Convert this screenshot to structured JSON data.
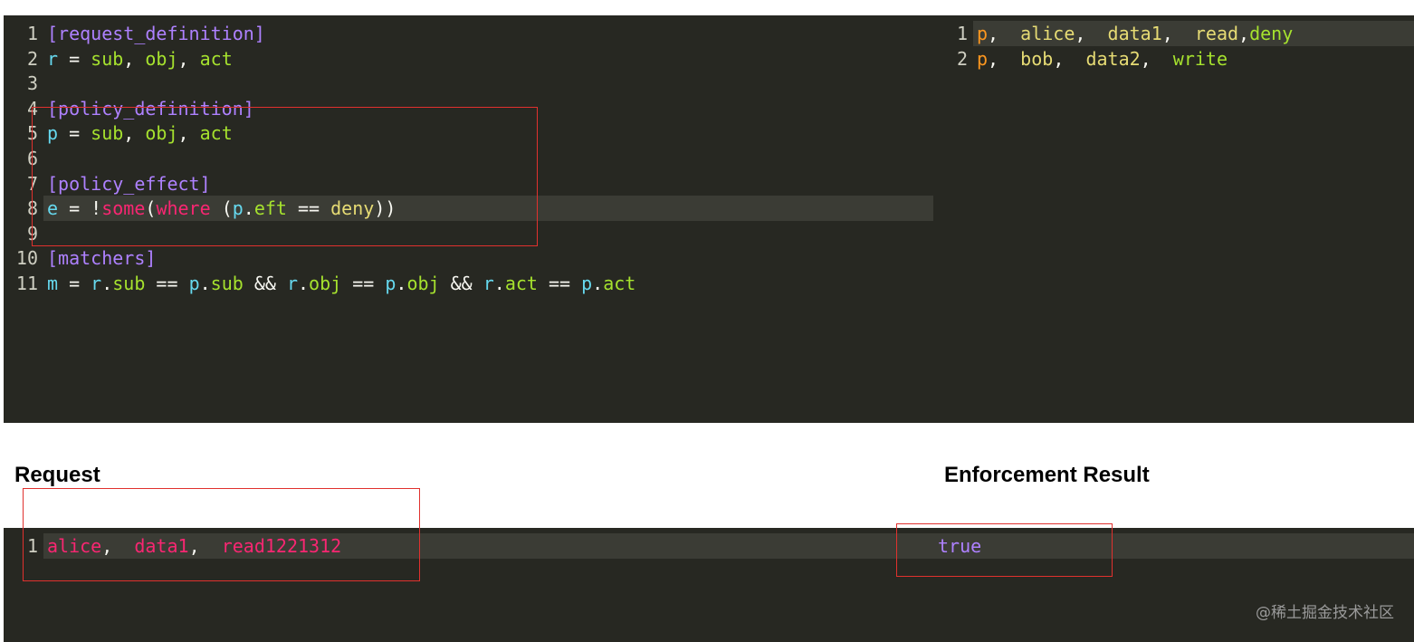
{
  "model_editor": {
    "lines": [
      {
        "n": "1",
        "tokens": [
          [
            "[request_definition]",
            "t-section"
          ]
        ]
      },
      {
        "n": "2",
        "tokens": [
          [
            "r",
            "t-var"
          ],
          [
            " = ",
            "t-op"
          ],
          [
            "sub",
            "t-green"
          ],
          [
            ", ",
            "t-op"
          ],
          [
            "obj",
            "t-green"
          ],
          [
            ", ",
            "t-op"
          ],
          [
            "act",
            "t-green"
          ]
        ]
      },
      {
        "n": "3",
        "tokens": []
      },
      {
        "n": "4",
        "tokens": [
          [
            "[policy_definition]",
            "t-section"
          ]
        ]
      },
      {
        "n": "5",
        "tokens": [
          [
            "p",
            "t-var"
          ],
          [
            " = ",
            "t-op"
          ],
          [
            "sub",
            "t-green"
          ],
          [
            ", ",
            "t-op"
          ],
          [
            "obj",
            "t-green"
          ],
          [
            ", ",
            "t-op"
          ],
          [
            "act",
            "t-green"
          ]
        ]
      },
      {
        "n": "6",
        "tokens": []
      },
      {
        "n": "7",
        "tokens": [
          [
            "[policy_effect]",
            "t-section"
          ]
        ]
      },
      {
        "n": "8",
        "active": true,
        "tokens": [
          [
            "e",
            "t-var"
          ],
          [
            " = ",
            "t-op"
          ],
          [
            "!",
            "t-op"
          ],
          [
            "some",
            "t-func"
          ],
          [
            "(",
            "t-op"
          ],
          [
            "where",
            "t-func"
          ],
          [
            " (",
            "t-op"
          ],
          [
            "p",
            "t-var"
          ],
          [
            ".",
            "t-op"
          ],
          [
            "eft",
            "t-green"
          ],
          [
            " == ",
            "t-op"
          ],
          [
            "deny",
            "t-yellow"
          ],
          [
            "))",
            "t-op"
          ]
        ]
      },
      {
        "n": "9",
        "tokens": []
      },
      {
        "n": "10",
        "tokens": [
          [
            "[matchers]",
            "t-section"
          ]
        ]
      },
      {
        "n": "11",
        "tokens": [
          [
            "m",
            "t-var"
          ],
          [
            " = ",
            "t-op"
          ],
          [
            "r",
            "t-var"
          ],
          [
            ".",
            "t-op"
          ],
          [
            "sub",
            "t-green"
          ],
          [
            " == ",
            "t-op"
          ],
          [
            "p",
            "t-var"
          ],
          [
            ".",
            "t-op"
          ],
          [
            "sub",
            "t-green"
          ],
          [
            " && ",
            "t-op"
          ],
          [
            "r",
            "t-var"
          ],
          [
            ".",
            "t-op"
          ],
          [
            "obj",
            "t-green"
          ],
          [
            " == ",
            "t-op"
          ],
          [
            "p",
            "t-var"
          ],
          [
            ".",
            "t-op"
          ],
          [
            "obj",
            "t-green"
          ],
          [
            " && ",
            "t-op"
          ],
          [
            "r",
            "t-var"
          ],
          [
            ".",
            "t-op"
          ],
          [
            "act",
            "t-green"
          ],
          [
            " == ",
            "t-op"
          ],
          [
            "p",
            "t-var"
          ],
          [
            ".",
            "t-op"
          ],
          [
            "act",
            "t-green"
          ]
        ]
      }
    ]
  },
  "policy_editor": {
    "lines": [
      {
        "n": "1",
        "active": true,
        "tokens": [
          [
            "p",
            "t-orange"
          ],
          [
            ", ",
            "t-op"
          ],
          [
            " alice",
            "t-yellow"
          ],
          [
            ", ",
            "t-op"
          ],
          [
            " data1",
            "t-yellow"
          ],
          [
            ", ",
            "t-op"
          ],
          [
            " read",
            "t-yellow"
          ],
          [
            ",",
            "t-op"
          ],
          [
            "deny",
            "t-green"
          ]
        ]
      },
      {
        "n": "2",
        "tokens": [
          [
            "p",
            "t-orange"
          ],
          [
            ", ",
            "t-op"
          ],
          [
            " bob",
            "t-yellow"
          ],
          [
            ", ",
            "t-op"
          ],
          [
            " data2",
            "t-yellow"
          ],
          [
            ", ",
            "t-op"
          ],
          [
            " write",
            "t-green"
          ]
        ]
      }
    ]
  },
  "request": {
    "heading": "Request",
    "lines": [
      {
        "n": "1",
        "active": true,
        "tokens": [
          [
            "alice",
            "t-func"
          ],
          [
            ", ",
            "t-op"
          ],
          [
            " data1",
            "t-func"
          ],
          [
            ", ",
            "t-op"
          ],
          [
            " read1221312",
            "t-func"
          ]
        ]
      }
    ]
  },
  "result": {
    "heading": "Enforcement Result",
    "lines": [
      {
        "n": "",
        "active": true,
        "tokens": [
          [
            "true",
            "t-purple"
          ]
        ]
      }
    ]
  },
  "watermark": "@稀土掘金技术社区"
}
